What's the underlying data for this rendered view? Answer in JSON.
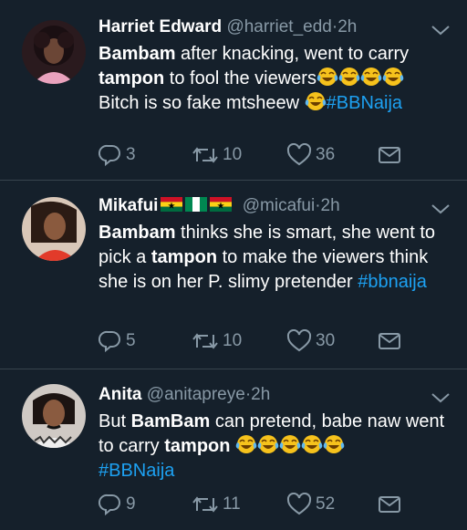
{
  "tweets": [
    {
      "name": "Harriet Edward",
      "handle": "@harriet_edd",
      "separator": "·",
      "time": "2h",
      "text": {
        "p1": "Bambam",
        "p2": " after knacking, went to carry",
        "p3": "tampon",
        "p4": " to fool the viewers",
        "p5": "Bitch is so fake mtsheew ",
        "hashtag": "#BBNaija"
      },
      "stats": {
        "replies": "3",
        "retweets": "10",
        "likes": "36"
      }
    },
    {
      "name": "Mikafui",
      "handle": "@micafui",
      "separator": "·",
      "time": "2h",
      "flags": [
        "Ghana",
        "Nigeria",
        "Ghana"
      ],
      "text": {
        "p1": "Bambam",
        "p2": " thinks she is smart, she went to pick a ",
        "p3": "tampon",
        "p4": " to make the viewers think she is on her P. slimy pretender ",
        "hashtag": "#bbnaija"
      },
      "stats": {
        "replies": "5",
        "retweets": "10",
        "likes": "30"
      }
    },
    {
      "name": "Anita",
      "handle": "@anitapreye",
      "separator": "·",
      "time": "2h",
      "text": {
        "p1": "But ",
        "p2": "BamBam",
        "p3": " can pretend, babe naw went to carry ",
        "p4": "tampon",
        "hashtag": "#BBNaija"
      },
      "stats": {
        "replies": "9",
        "retweets": "11",
        "likes": "52"
      }
    }
  ],
  "colors": {
    "background": "#15202b",
    "divider": "#38444d",
    "muted": "#8899a6",
    "link": "#1da1f2"
  },
  "icons": {
    "reply": "reply-icon",
    "retweet": "retweet-icon",
    "like": "heart-icon",
    "share": "share-icon",
    "more": "chevron-down-icon",
    "emoji": "laughing-tears-emoji"
  }
}
